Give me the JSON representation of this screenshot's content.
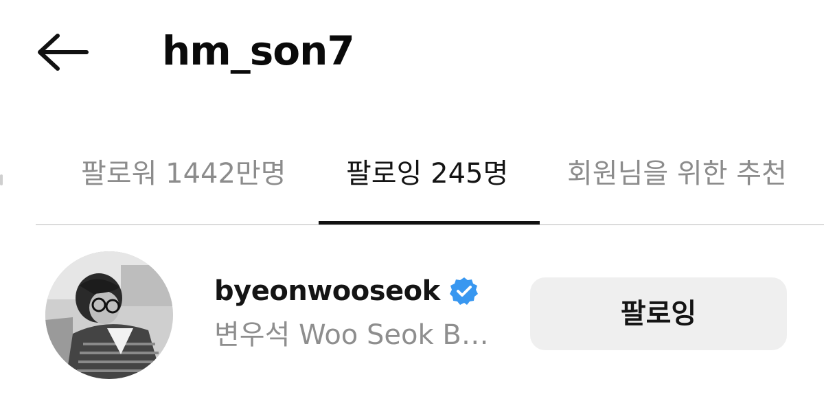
{
  "header": {
    "back_icon": "back-arrow-icon",
    "title": "hm_son7"
  },
  "tabs": [
    {
      "label": "팔로워 1442만명",
      "active": false
    },
    {
      "label": "팔로잉 245명",
      "active": true
    },
    {
      "label": "회원님을 위한 추천",
      "active": false
    }
  ],
  "following_list": [
    {
      "username": "byeonwooseok",
      "verified": true,
      "verified_icon": "verified-badge-icon",
      "subtitle": "변우석  Woo Seok B…",
      "button_label": "팔로잉"
    }
  ],
  "colors": {
    "verified_blue": "#3897f0",
    "button_bg": "#efefef",
    "inactive_tab_text": "#8c8c8c",
    "active_tab_text": "#141414"
  }
}
